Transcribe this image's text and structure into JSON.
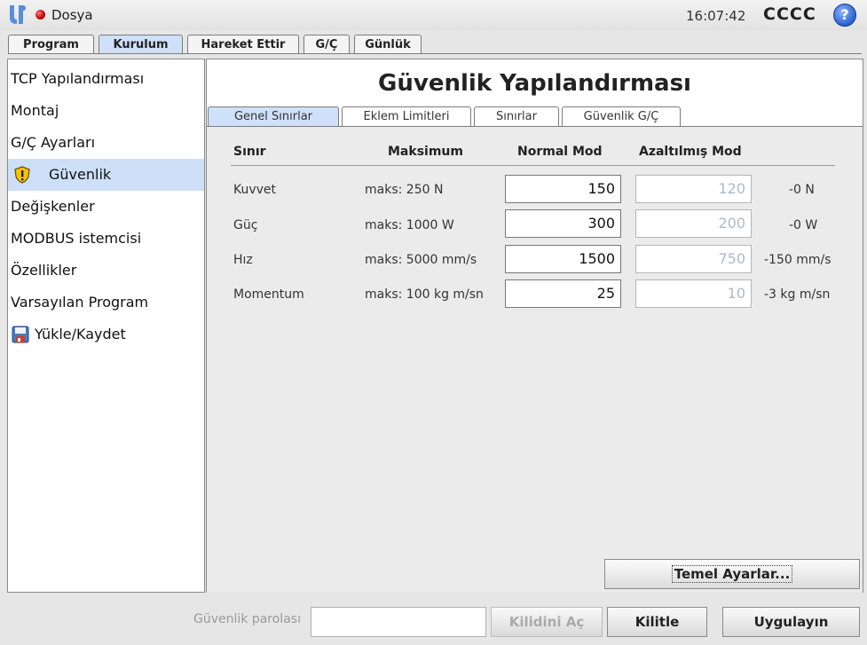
{
  "app": {
    "menu_file": "Dosya",
    "clock": "16:07:42",
    "robot_name": "CCCC",
    "help_symbol": "?",
    "status_color": "#cc0000"
  },
  "top_tabs": [
    "Program",
    "Kurulum",
    "Hareket Ettir",
    "G/Ç",
    "Günlük"
  ],
  "top_tabs_active": "Kurulum",
  "sidebar": {
    "items": [
      {
        "label": "TCP Yapılandırması",
        "icon": ""
      },
      {
        "label": "Montaj",
        "icon": ""
      },
      {
        "label": "G/Ç Ayarları",
        "icon": ""
      },
      {
        "label": "Güvenlik",
        "icon": "warning-shield-icon"
      },
      {
        "label": "Değişkenler",
        "icon": ""
      },
      {
        "label": "MODBUS istemcisi",
        "icon": ""
      },
      {
        "label": "Özellikler",
        "icon": ""
      },
      {
        "label": "Varsayılan Program",
        "icon": ""
      },
      {
        "label": "Yükle/Kaydet",
        "icon": "floppy-disk-icon"
      }
    ],
    "active": "Güvenlik"
  },
  "main": {
    "title": "Güvenlik Yapılandırması",
    "tabs": [
      "Genel Sınırlar",
      "Eklem Limitleri",
      "Sınırlar",
      "Güvenlik G/Ç"
    ],
    "active_tab": "Genel Sınırlar",
    "table": {
      "headers": [
        "Sınır",
        "Maksimum",
        "Normal Mod",
        "Azaltılmış Mod"
      ],
      "rows": [
        {
          "name": "Kuvvet",
          "max": "maks: 250 N",
          "normal": "150",
          "reduced": "120",
          "delta": "-0 N"
        },
        {
          "name": "Güç",
          "max": "maks: 1000 W",
          "normal": "300",
          "reduced": "200",
          "delta": "-0 W"
        },
        {
          "name": "Hız",
          "max": "maks: 5000 mm/s",
          "normal": "1500",
          "reduced": "750",
          "delta": "-150 mm/s"
        },
        {
          "name": "Momentum",
          "max": "maks: 100 kg m/sn",
          "normal": "25",
          "reduced": "10",
          "delta": "-3 kg m/sn"
        }
      ]
    },
    "basic_settings_button": "Temel Ayarlar..."
  },
  "bottom": {
    "password_label": "Güvenlik parolası",
    "password_value": "",
    "unlock_button": "Kilidini Aç",
    "lock_button": "Kilitle",
    "apply_button": "Uygulayın"
  }
}
